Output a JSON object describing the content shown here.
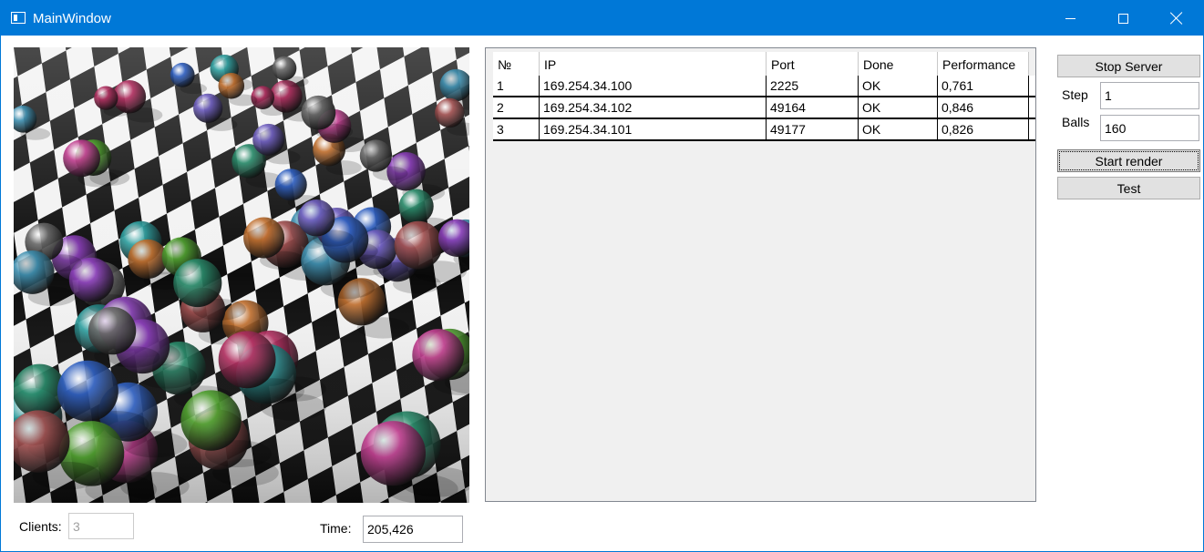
{
  "window": {
    "title": "MainWindow"
  },
  "render": {
    "description_icon": "raytraced-spheres-image"
  },
  "bottom": {
    "clients_label": "Clients:",
    "clients_value": "3",
    "time_label": "Time:",
    "time_value": "205,426"
  },
  "grid": {
    "columns": [
      "№",
      "IP",
      "Port",
      "Done",
      "Performance"
    ],
    "rows": [
      [
        "1",
        "169.254.34.100",
        "2225",
        "OK",
        "0,761"
      ],
      [
        "2",
        "169.254.34.102",
        "49164",
        "OK",
        "0,846"
      ],
      [
        "3",
        "169.254.34.101",
        "49177",
        "OK",
        "0,826"
      ]
    ]
  },
  "controls": {
    "stop_server_label": "Stop Server",
    "step_label": "Step",
    "step_value": "1",
    "balls_label": "Balls",
    "balls_value": "160",
    "start_render_label": "Start render",
    "test_label": "Test"
  },
  "colors": {
    "titlebar": "#0078d7",
    "button_face": "#e1e1e1"
  }
}
